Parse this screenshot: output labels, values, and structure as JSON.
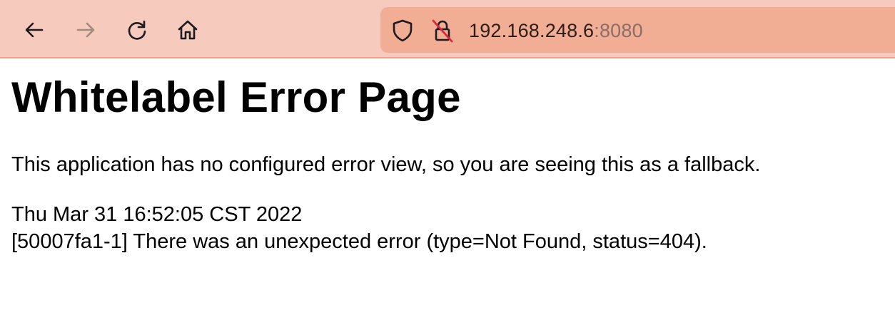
{
  "browser": {
    "url_host": "192.168.248.6",
    "url_port": ":8080",
    "toolbar_color": "#f6cbbd",
    "urlbar_color": "#f2ad95",
    "icons": {
      "back": "arrow-left-icon",
      "forward": "arrow-right-icon",
      "reload": "reload-icon",
      "home": "home-icon",
      "shield": "shield-icon",
      "insecure_lock": "insecure-lock-icon"
    }
  },
  "page": {
    "heading": "Whitelabel Error Page",
    "description": "This application has no configured error view, so you are seeing this as a fallback.",
    "timestamp": "Thu Mar 31 16:52:05 CST 2022",
    "error_message": "[50007fa1-1] There was an unexpected error (type=Not Found, status=404)."
  }
}
